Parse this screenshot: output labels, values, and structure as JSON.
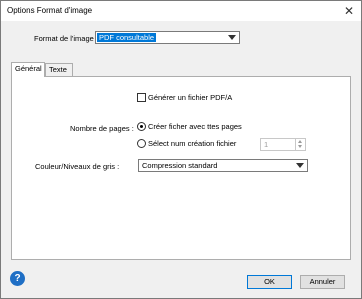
{
  "window": {
    "title": "Options Format d'image"
  },
  "format": {
    "label": "Format de l'image :",
    "value": "PDF consultable"
  },
  "tabs": [
    {
      "label": "Général"
    },
    {
      "label": "Texte"
    }
  ],
  "general": {
    "pdfa_checkbox_label": "Générer un fichier PDF/A",
    "pages_label": "Nombre de pages :",
    "radio_all_label": "Créer ficher avec ttes pages",
    "radio_select_label": "Sélect num création fichier",
    "spin_value": "1",
    "color_label": "Couleur/Niveaux de gris :",
    "color_value": "Compression standard"
  },
  "buttons": {
    "ok": "OK",
    "cancel": "Annuler"
  },
  "icons": {
    "help": "?",
    "close": "✕"
  }
}
